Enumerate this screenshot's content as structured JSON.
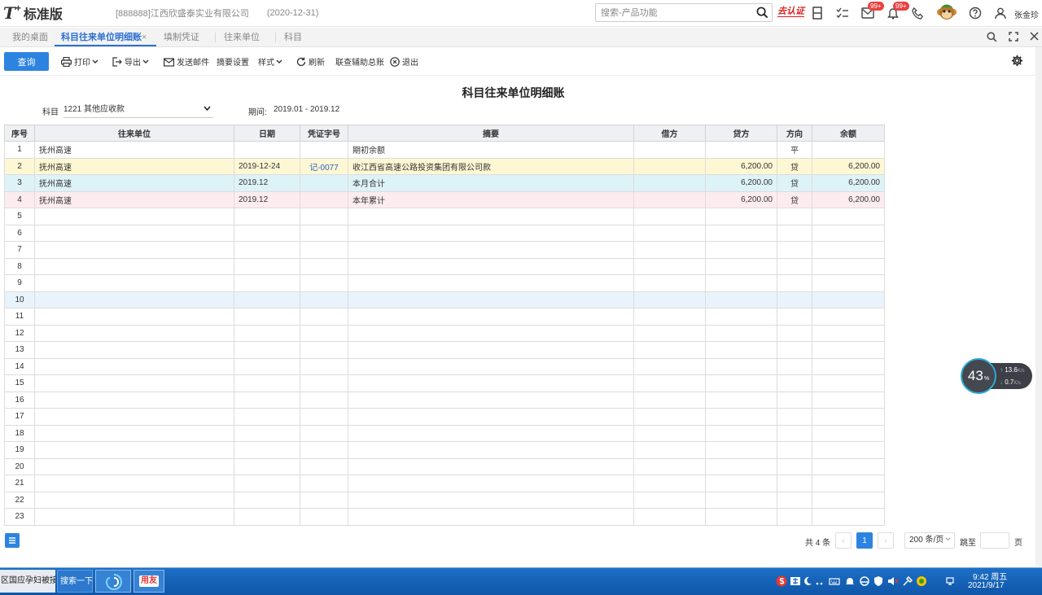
{
  "header": {
    "logo_mark": "T",
    "logo_plus": "+",
    "app_name": "标准版",
    "company": "[888888]江西欣盛泰实业有限公司",
    "period": "(2020-12-31)",
    "search_placeholder": "搜索-产品功能",
    "auth_badge": "去认证",
    "msg_badge": "99+",
    "notify_badge": "99+",
    "user_name": "张金珍"
  },
  "tabs": [
    {
      "label": "我的桌面",
      "active": false
    },
    {
      "label": "科目往来单位明细账",
      "active": true
    },
    {
      "label": "填制凭证",
      "active": false
    },
    {
      "label": "往来单位",
      "active": false
    },
    {
      "label": "科目",
      "active": false
    }
  ],
  "tab_close": "×",
  "toolbar": {
    "query": "查询",
    "print": "打印",
    "export": "导出",
    "send_mail": "发送邮件",
    "summary_settings": "摘要设置",
    "style": "样式",
    "refresh": "刷新",
    "linked_aux": "联查辅助总账",
    "exit": "退出"
  },
  "report": {
    "title": "科目往来单位明细账",
    "subject_label": "科目",
    "subject_value": "1221 其他应收款",
    "period_label": "期间:",
    "period_value": "2019.01 - 2019.12"
  },
  "table": {
    "columns": [
      "序号",
      "往来单位",
      "日期",
      "凭证字号",
      "摘要",
      "借方",
      "贷方",
      "方向",
      "余额"
    ],
    "rows": [
      {
        "no": "1",
        "unit": "抚州高速",
        "date": "",
        "voucher": "",
        "summary": "期初余额",
        "debit": "",
        "credit": "",
        "dir": "平",
        "balance": ""
      },
      {
        "no": "2",
        "unit": "抚州高速",
        "date": "2019-12-24",
        "voucher": "记-0077",
        "summary": "收江西省高速公路投资集团有限公司款",
        "debit": "",
        "credit": "6,200.00",
        "dir": "贷",
        "balance": "6,200.00"
      },
      {
        "no": "3",
        "unit": "抚州高速",
        "date": "2019.12",
        "voucher": "",
        "summary": "本月合计",
        "debit": "",
        "credit": "6,200.00",
        "dir": "贷",
        "balance": "6,200.00"
      },
      {
        "no": "4",
        "unit": "抚州高速",
        "date": "2019.12",
        "voucher": "",
        "summary": "本年累计",
        "debit": "",
        "credit": "6,200.00",
        "dir": "贷",
        "balance": "6,200.00"
      },
      {
        "no": "5"
      },
      {
        "no": "6"
      },
      {
        "no": "7"
      },
      {
        "no": "8"
      },
      {
        "no": "9"
      },
      {
        "no": "10"
      },
      {
        "no": "11"
      },
      {
        "no": "12"
      },
      {
        "no": "13"
      },
      {
        "no": "14"
      },
      {
        "no": "15"
      },
      {
        "no": "16"
      },
      {
        "no": "17"
      },
      {
        "no": "18"
      },
      {
        "no": "19"
      },
      {
        "no": "20"
      },
      {
        "no": "21"
      },
      {
        "no": "22"
      },
      {
        "no": "23"
      }
    ]
  },
  "pager": {
    "total": "共 4 条",
    "prev": "‹",
    "current": "1",
    "next": "›",
    "page_size": "200 条/页",
    "jump_label": "跳至",
    "page_suffix": "页"
  },
  "speed_widget": {
    "percent": "43",
    "percent_sign": "%",
    "up": "13.6",
    "up_unit": "K/s",
    "down": "0.7",
    "down_unit": "K/s"
  },
  "taskbar": {
    "item1": "区国应孕妇被接...",
    "item2": "搜索一下",
    "item4": "用友",
    "time": "9:42 周五",
    "date": "2021/9/17"
  },
  "colors": {
    "accent": "#2d83e0",
    "row_yellow": "#fdf7d4",
    "row_cyan": "#def3f8",
    "row_pink": "#fdecef"
  }
}
